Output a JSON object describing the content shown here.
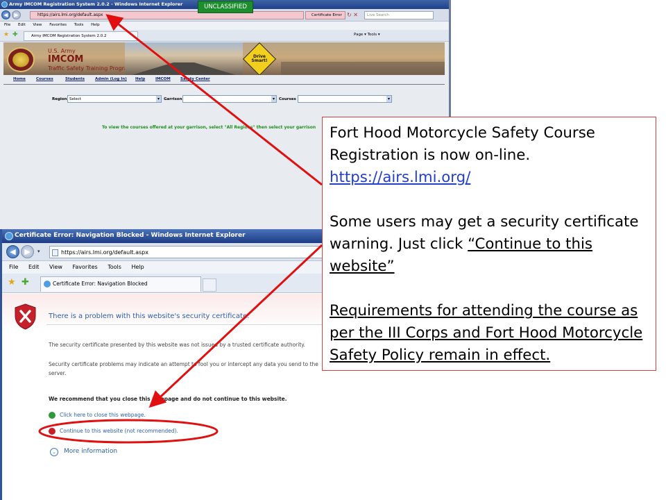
{
  "top_window": {
    "title": "Army IMCOM Registration System 2.0.2 - Windows Internet Explorer",
    "classification": "UNCLASSIFIED",
    "url": "https://airs.lmi.org/default.aspx",
    "cert_error": "Certificate Error",
    "search_placeholder": "Live Search",
    "menu": [
      "File",
      "Edit",
      "View",
      "Favorites",
      "Tools",
      "Help"
    ],
    "tab": "Army IMCOM Registration System 2.0.2",
    "toolbar_right": "Page ▾  Tools ▾",
    "banner": {
      "line1": "U.S. Army",
      "line2": "IMCOM",
      "line3": "Traffic Safety Training Program",
      "sign": "Drive Smart!"
    },
    "nav": [
      "Home",
      "Courses",
      "Students",
      "Admin (Log In)",
      "Help",
      "IMCOM",
      "Safety Center"
    ],
    "form": {
      "region_label": "Region",
      "region_value": "Select",
      "garrison_label": "Garrison",
      "courses_label": "Courses"
    },
    "instruction": "To view the courses offered at your garrison, select \"All Regions\" then select your garrison"
  },
  "bottom_window": {
    "title": "Certificate Error: Navigation Blocked - Windows Internet Explorer",
    "url": "https://airs.lmi.org/default.aspx",
    "menu": [
      "File",
      "Edit",
      "View",
      "Favorites",
      "Tools",
      "Help"
    ],
    "tab": "Certificate Error: Navigation Blocked",
    "heading": "There is a problem with this website's security certificate.",
    "para1": "The security certificate presented by this website was not issued by a trusted certificate authority.",
    "para2a": "Security certificate problems may indicate an attempt to fool you or intercept any data you send to the",
    "para2b": "server.",
    "recommend": "We recommend that you close this webpage and do not continue to this website.",
    "close_link": "Click here to close this webpage.",
    "continue_link": "Continue to this website (not recommended).",
    "more_info": "More information"
  },
  "callout": {
    "line1": "Fort Hood Motorcycle Safety Course Registration is now on-line.",
    "link": "https://airs.lmi.org/",
    "warn_prefix": "Some users may get a security certificate warning.  Just click ",
    "warn_link": "“Continue to this website”",
    "requirements": "Requirements for attending the course as per the III Corps and Fort Hood Motorcycle Safety Policy remain in effect."
  },
  "colors": {
    "arrow": "#e01010",
    "classification_bg": "#1d8d2e",
    "link_blue": "#1f3fcc"
  }
}
